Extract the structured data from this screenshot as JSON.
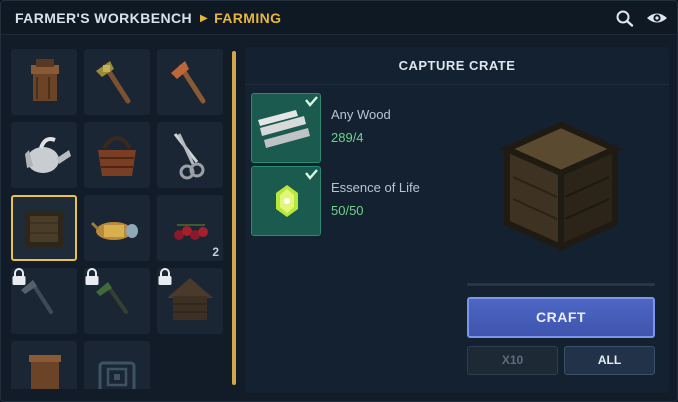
{
  "header": {
    "workbench": "FARMER'S WORKBENCH",
    "category": "FARMING",
    "separator_icon": "play-triangle-icon",
    "search_icon": "magnifier-icon",
    "visibility_icon": "eye-icon"
  },
  "recipe_grid": {
    "items": [
      {
        "name": "item-wooden-post",
        "icon": "wooden-post-icon",
        "locked": false,
        "selected": false
      },
      {
        "name": "item-bronze-hoe",
        "icon": "hoe-icon",
        "locked": false,
        "selected": false
      },
      {
        "name": "item-copper-hoe",
        "icon": "hoe-icon",
        "locked": false,
        "selected": false
      },
      {
        "name": "item-watering-can",
        "icon": "watering-can-icon",
        "locked": false,
        "selected": false
      },
      {
        "name": "item-basket",
        "icon": "basket-icon",
        "locked": false,
        "selected": false
      },
      {
        "name": "item-shears",
        "icon": "shears-icon",
        "locked": false,
        "selected": false
      },
      {
        "name": "item-capture-crate",
        "icon": "crate-icon",
        "locked": false,
        "selected": true
      },
      {
        "name": "item-seed-spreader",
        "icon": "seed-spreader-icon",
        "locked": false,
        "selected": false
      },
      {
        "name": "item-berries",
        "icon": "berries-icon",
        "locked": false,
        "selected": false,
        "count": "2"
      },
      {
        "name": "item-iron-hoe",
        "icon": "hoe-icon",
        "locked": true,
        "selected": false
      },
      {
        "name": "item-green-hoe",
        "icon": "hoe-icon",
        "locked": true,
        "selected": false
      },
      {
        "name": "item-birdhouse",
        "icon": "birdhouse-icon",
        "locked": true,
        "selected": false
      },
      {
        "name": "item-wooden-box",
        "icon": "wooden-box-icon",
        "locked": false,
        "selected": false
      },
      {
        "name": "item-stone-plate",
        "icon": "stone-plate-icon",
        "locked": false,
        "selected": false
      }
    ]
  },
  "recipe": {
    "title": "CAPTURE CRATE",
    "ingredients": [
      {
        "name": "Any Wood",
        "quantity": "289/4",
        "icon": "wood-planks-icon",
        "satisfied": true
      },
      {
        "name": "Essence of Life",
        "quantity": "50/50",
        "icon": "essence-crystal-icon",
        "satisfied": true
      }
    ],
    "preview_icon": "crate-icon"
  },
  "actions": {
    "craft_label": "CRAFT",
    "x10_label": "X10",
    "all_label": "ALL"
  },
  "colors": {
    "accent_gold": "#e6b63f",
    "ingredient_ok": "#6ed38a",
    "craft_blue": "#4d66c4"
  }
}
